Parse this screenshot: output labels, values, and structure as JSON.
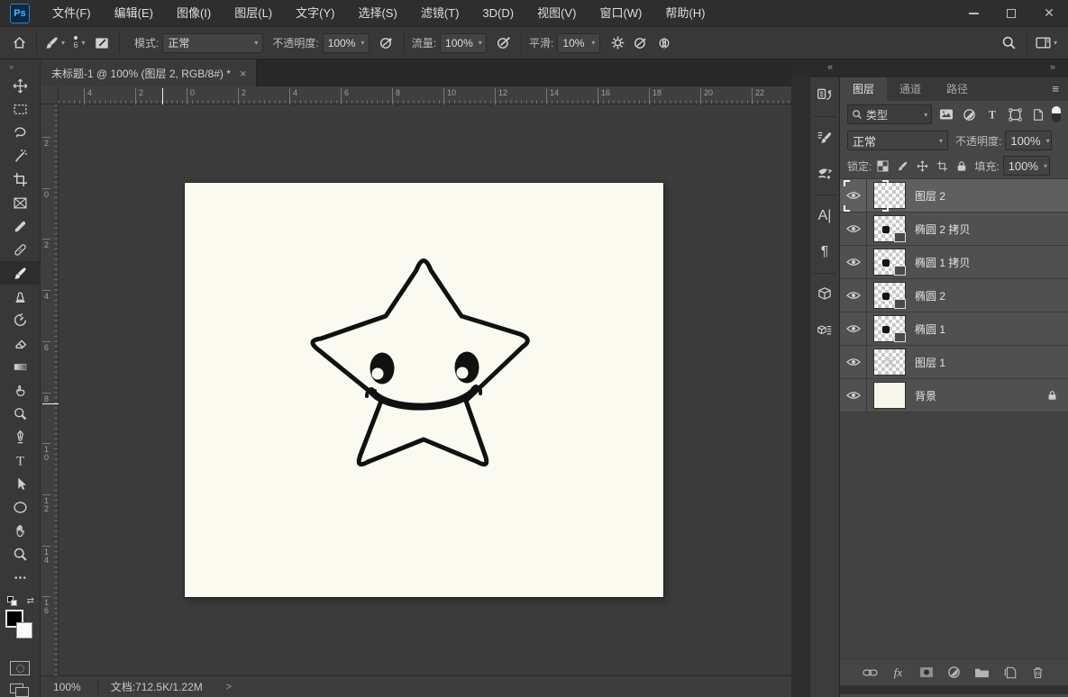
{
  "menubar": {
    "logo": "Ps",
    "items": [
      "文件(F)",
      "编辑(E)",
      "图像(I)",
      "图层(L)",
      "文字(Y)",
      "选择(S)",
      "滤镜(T)",
      "3D(D)",
      "视图(V)",
      "窗口(W)",
      "帮助(H)"
    ]
  },
  "options": {
    "brush_size": "6",
    "mode_label": "模式:",
    "mode_value": "正常",
    "opacity_label": "不透明度:",
    "opacity_value": "100%",
    "flow_label": "流量:",
    "flow_value": "100%",
    "smooth_label": "平滑:",
    "smooth_value": "10%"
  },
  "tabbar": {
    "title": "未标题-1 @ 100% (图层 2, RGB/8#) *",
    "close_glyph": "×"
  },
  "rulers": {
    "top": [
      "4",
      "2",
      "0",
      "2",
      "4",
      "6",
      "8",
      "10",
      "12",
      "14",
      "16",
      "18",
      "20",
      "22"
    ],
    "left": [
      "2",
      "0",
      "2",
      "4",
      "6",
      "8",
      "10",
      "12",
      "14",
      "16"
    ]
  },
  "dock_header": {
    "collapse_left": "«",
    "expand_right": "»"
  },
  "layers_panel": {
    "tabs": [
      {
        "label": "图层",
        "active": true
      },
      {
        "label": "通道",
        "active": false
      },
      {
        "label": "路径",
        "active": false
      }
    ],
    "search_label": "类型",
    "blend_mode": "正常",
    "opacity_label": "不透明度:",
    "opacity_value": "100%",
    "lock_label": "锁定:",
    "fill_label": "填充:",
    "fill_value": "100%",
    "layers": [
      {
        "name": "图层 2",
        "kind": "empty",
        "selected": true,
        "locked": false
      },
      {
        "name": "椭圆 2 拷贝",
        "kind": "shape",
        "selected": false,
        "locked": false
      },
      {
        "name": "椭圆 1 拷贝",
        "kind": "shape",
        "selected": false,
        "locked": false
      },
      {
        "name": "椭圆 2",
        "kind": "shape",
        "selected": false,
        "locked": false
      },
      {
        "name": "椭圆 1",
        "kind": "shape",
        "selected": false,
        "locked": false
      },
      {
        "name": "图层 1",
        "kind": "star",
        "selected": false,
        "locked": false
      },
      {
        "name": "背景",
        "kind": "background",
        "selected": false,
        "locked": true
      }
    ]
  },
  "statusbar": {
    "zoom": "100%",
    "doc_info": "文档:712.5K/1.22M"
  },
  "canvas": {
    "drawing": "smiling star outline",
    "artboard_color": "#fbfaf1",
    "line_color": "#111111"
  },
  "colors": {
    "accent_blue": "#4db3ff",
    "selected_row": "#5f5f5f"
  }
}
